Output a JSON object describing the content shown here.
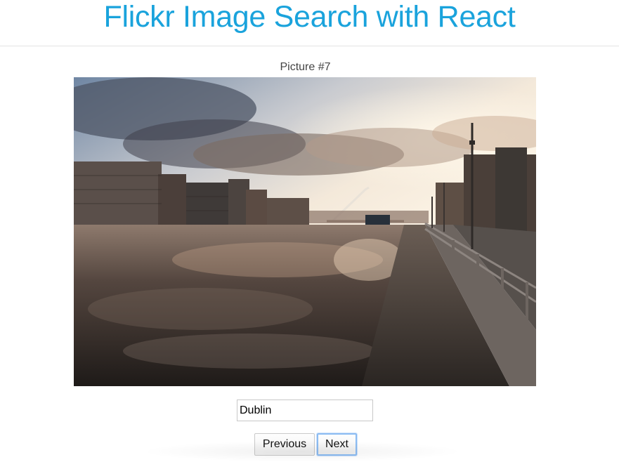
{
  "header": {
    "title": "Flickr Image Search with React"
  },
  "gallery": {
    "caption": "Picture #7",
    "image_description": "Dublin"
  },
  "search": {
    "value": "Dublin"
  },
  "navigation": {
    "previous_label": "Previous",
    "next_label": "Next"
  },
  "colors": {
    "title": "#1aa3dc",
    "focus_ring": "#8cbcf2"
  }
}
